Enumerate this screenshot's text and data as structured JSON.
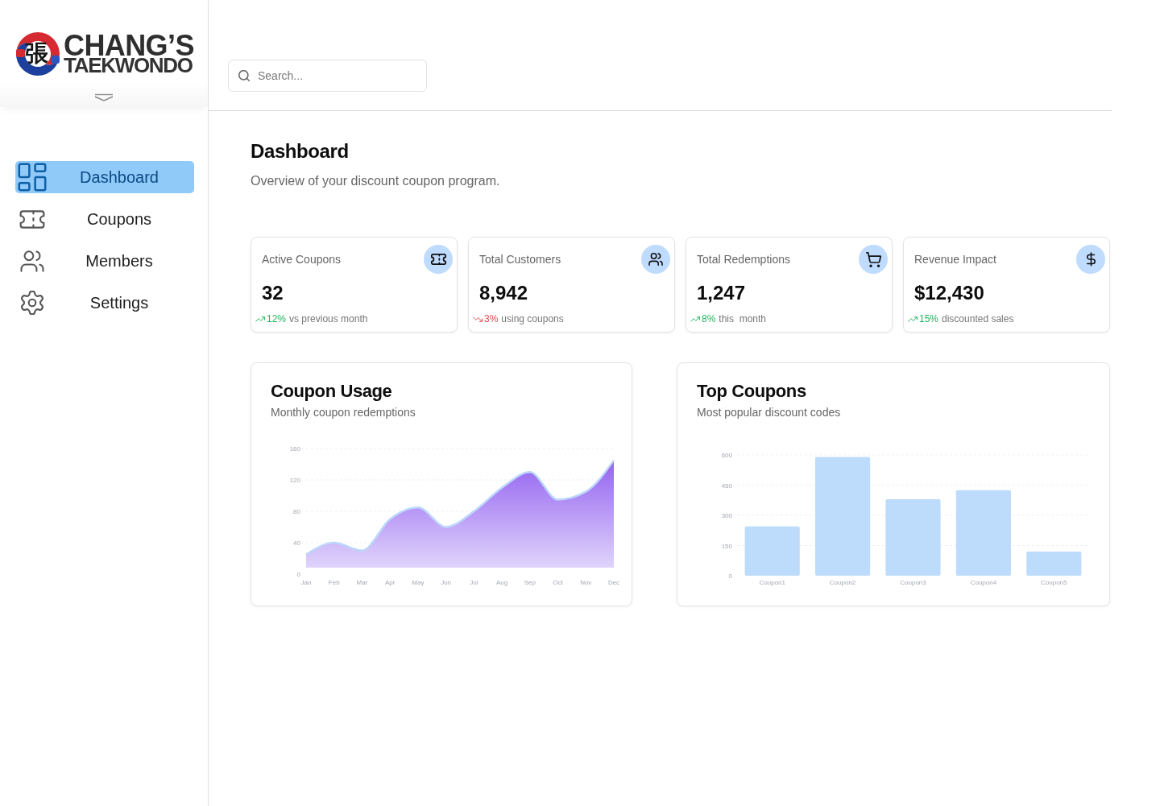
{
  "sidebar": {
    "logo": {
      "mark": "張",
      "name": "CHANG’S",
      "tagline": "TAEKWONDO"
    },
    "nav": [
      {
        "label": "Dashboard",
        "selected": true
      },
      {
        "label": "Coupons",
        "selected": false
      },
      {
        "label": "Members",
        "selected": false
      },
      {
        "label": "Settings",
        "selected": false
      }
    ]
  },
  "search": {
    "placeholder": "Search..."
  },
  "page": {
    "title": "Dashboard",
    "subtitle": "Overview of your discount coupon program."
  },
  "stats": [
    {
      "title": "Active Coupons",
      "value": "32",
      "change": "12%",
      "trend_up": true,
      "note": "vs previous month"
    },
    {
      "title": "Total Customers",
      "value": "8,942",
      "change": "3%",
      "trend_up": false,
      "note": "using coupons"
    },
    {
      "title": "Total Redemptions",
      "value": "1,247",
      "change": "8%",
      "trend_up": true,
      "note": "this  month"
    },
    {
      "title": "Revenue Impact",
      "value": "$12,430",
      "change": "15%",
      "trend_up": true,
      "note": "discounted sales"
    }
  ],
  "charts": [
    {
      "title": "Coupon Usage",
      "subtitle": "Monthly coupon redemptions",
      "chart_data": {
        "type": "area",
        "categories": [
          "Jan",
          "Feb",
          "Mar",
          "Apr",
          "May",
          "Jun",
          "Jul",
          "Aug",
          "Sep",
          "Oct",
          "Nov",
          "Dec"
        ],
        "values": [
          25,
          40,
          30,
          70,
          85,
          60,
          80,
          110,
          130,
          95,
          105,
          145
        ],
        "ylim": [
          0,
          160
        ],
        "yticks": [
          0,
          40,
          80,
          120,
          160
        ],
        "grid": true
      }
    },
    {
      "title": "Top Coupons",
      "subtitle": "Most popular discount codes",
      "chart_data": {
        "type": "bar",
        "categories": [
          "Coupon1",
          "Coupon2",
          "Coupon3",
          "Coupon4",
          "Coupon5"
        ],
        "values": [
          245,
          590,
          380,
          425,
          120
        ],
        "ylim": [
          0,
          600
        ],
        "yticks": [
          0,
          150,
          300,
          450,
          600
        ],
        "grid": true
      }
    }
  ]
}
